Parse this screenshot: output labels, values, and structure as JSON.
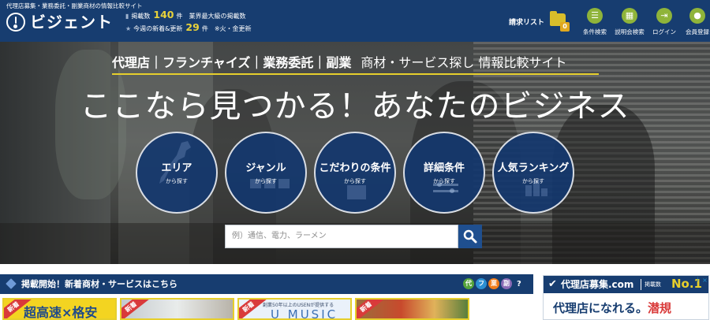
{
  "header": {
    "tagline": "代理店募集・業務委託・副業商材の情報比較サイト",
    "logo_text": "ビジェント",
    "listed": {
      "label": "掲載数",
      "count": "140",
      "unit": "件",
      "note": "業界最大級の掲載数"
    },
    "weekly": {
      "label": "今週の新着&更新",
      "count": "29",
      "unit": "件",
      "note": "※火・金更新"
    },
    "request_list": {
      "label": "請求リスト",
      "count": "0"
    },
    "nav": [
      {
        "label": "条件検索",
        "icon": "list-icon"
      },
      {
        "label": "説明会検索",
        "icon": "calendar-icon"
      },
      {
        "label": "ログイン",
        "icon": "login-icon"
      },
      {
        "label": "会員登録",
        "icon": "user-icon"
      }
    ],
    "colors": {
      "navy": "#173d70",
      "accent_green": "#8fb43a",
      "highlight": "#e8d23a"
    }
  },
  "hero": {
    "categories": "代理店｜フランチャイズ｜業務委託｜副業",
    "category_sub": "商材・サービス探し 情報比較サイト",
    "headline": "ここなら見つかる！あなたのビジネス",
    "search_circles": [
      {
        "main": "エリア",
        "sub": "から探す"
      },
      {
        "main": "ジャンル",
        "sub": "から探す"
      },
      {
        "main": "こだわりの条件",
        "sub": "から探す"
      },
      {
        "main": "詳細条件",
        "sub": "から探す"
      },
      {
        "main": "人気ランキング",
        "sub": "から探す"
      }
    ],
    "search": {
      "placeholder": "例）通信、電力、ラーメン"
    }
  },
  "new_arrivals": {
    "title": "掲載開始！新着商材・サービスはこちら",
    "type_badges": [
      "代",
      "フ",
      "業",
      "副"
    ],
    "help": "?",
    "new_label": "新着",
    "thumbs": [
      {
        "text": "超高速×格安"
      },
      {
        "text": ""
      },
      {
        "small": "創業50年以上のUSENが提供する",
        "text": "U MUSIC"
      },
      {
        "text": ""
      }
    ]
  },
  "ad": {
    "site": "代理店募集.com",
    "listed": "掲載数",
    "rank": "No.1",
    "info": "i",
    "close": "×",
    "catch_main": "代理店になれる。",
    "catch_accent": "潜規"
  }
}
